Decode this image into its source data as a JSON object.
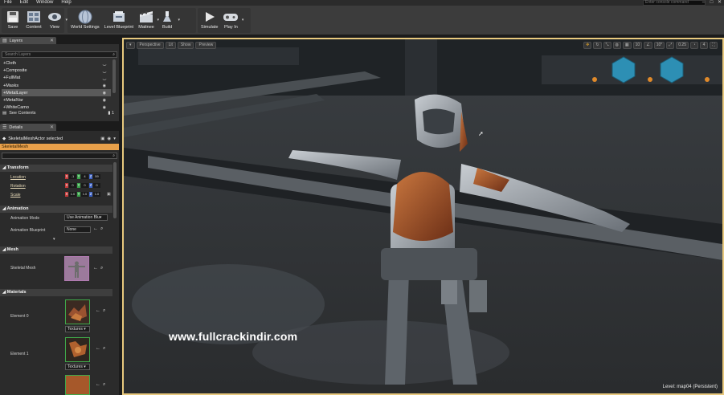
{
  "menubar": {
    "items": [
      "File",
      "Edit",
      "Window",
      "Help"
    ],
    "console_placeholder": "Enter console command"
  },
  "window_buttons": [
    "–",
    "□",
    "✕"
  ],
  "toolbar": {
    "buttons": [
      {
        "label": "Save",
        "icon": "save-icon"
      },
      {
        "label": "Content",
        "icon": "content-icon"
      },
      {
        "label": "View",
        "icon": "view-icon"
      },
      {
        "label": "World Settings",
        "icon": "world-settings-icon"
      },
      {
        "label": "Level Blueprint",
        "icon": "level-blueprint-icon"
      },
      {
        "label": "Matinee",
        "icon": "matinee-icon"
      },
      {
        "label": "Build",
        "icon": "build-icon"
      },
      {
        "label": "Simulate",
        "icon": "simulate-icon"
      },
      {
        "label": "Play In",
        "icon": "play-icon"
      }
    ]
  },
  "layers": {
    "tab_label": "Layers",
    "search_placeholder": "Search Layers",
    "items": [
      {
        "label": "+Cloth",
        "visible": false
      },
      {
        "label": "+Composite",
        "visible": false
      },
      {
        "label": "+FullMat",
        "visible": false
      },
      {
        "label": "+Masks",
        "visible": true
      },
      {
        "label": "+MetalLayer",
        "visible": true
      },
      {
        "label": "+MetalVar",
        "visible": true
      },
      {
        "label": "+WhiteCamo",
        "visible": true
      }
    ],
    "see_contents": "See Contents",
    "count": "1"
  },
  "details": {
    "tab_label": "Details",
    "selection_text": "SkeletalMeshActor selected",
    "actor_name": "SkeletalMesh",
    "search_placeholder": "",
    "transform": {
      "header": "Transform",
      "location": {
        "label": "Location",
        "x": "-1",
        "y": "4",
        "z": "59"
      },
      "rotation": {
        "label": "Rotation",
        "x": "0",
        "y": "0",
        "z": "0"
      },
      "scale": {
        "label": "Scale",
        "x": "1.0",
        "y": "1.0",
        "z": "1.0"
      }
    },
    "animation": {
      "header": "Animation",
      "mode_label": "Animation Mode",
      "mode_value": "Use Animation Blu▾",
      "blueprint_label": "Animation Blueprint",
      "blueprint_value": "None"
    },
    "mesh": {
      "header": "Mesh",
      "label": "Skeletal Mesh"
    },
    "materials": {
      "header": "Materials",
      "elements": [
        {
          "label": "Element 0",
          "dropdown": "Textures ▾"
        },
        {
          "label": "Element 1",
          "dropdown": "Textures ▾"
        }
      ]
    }
  },
  "viewport": {
    "left_buttons": [
      "Perspective",
      "Lit",
      "Show",
      "Preview"
    ],
    "right_icons": [
      "10",
      "10°",
      "0.25",
      "4"
    ],
    "level_label": "Level:  map04 (Persistent)",
    "watermark": "www.fullcrackindir.com"
  },
  "colors": {
    "accent": "#e8c97e",
    "selection": "#e8a04a",
    "x_axis": "#c43a3a",
    "y_axis": "#3aa34a",
    "z_axis": "#3a5fc4"
  }
}
